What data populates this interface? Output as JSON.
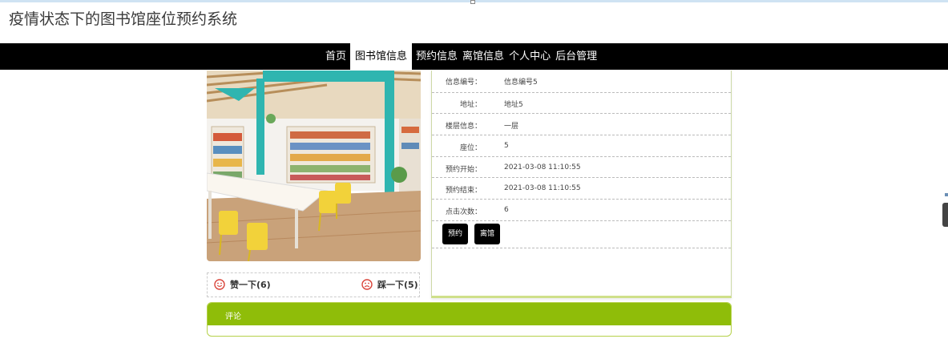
{
  "site": {
    "title": "疫情状态下的图书馆座位预约系统"
  },
  "nav": {
    "items": [
      {
        "label": "首页",
        "active": false
      },
      {
        "label": "图书馆信息",
        "active": true
      },
      {
        "label": "预约信息",
        "active": false
      },
      {
        "label": "离馆信息",
        "active": false
      },
      {
        "label": "个人中心",
        "active": false
      },
      {
        "label": "后台管理",
        "active": false
      }
    ]
  },
  "details": {
    "rows": [
      {
        "label": "信息编号：",
        "value": "信息编号5"
      },
      {
        "label": "地址：",
        "value": "地址5"
      },
      {
        "label": "楼层信息：",
        "value": "一层"
      },
      {
        "label": "座位：",
        "value": "5"
      },
      {
        "label": "预约开始：",
        "value": "2021-03-08 11:10:55"
      },
      {
        "label": "预约结束：",
        "value": "2021-03-08 11:10:55"
      },
      {
        "label": "点击次数：",
        "value": "6"
      }
    ],
    "buttons": {
      "reserve": "预约",
      "leave": "离馆"
    }
  },
  "votes": {
    "like_label": "赞一下(6)",
    "dislike_label": "踩一下(5)"
  },
  "comments": {
    "title": "评论"
  },
  "colors": {
    "accent": "#8fbd09",
    "nav_bg": "#000000",
    "teal": "#2fb5b0",
    "chair": "#f2d23a"
  },
  "icons": {
    "like": "smile-icon",
    "dislike": "frown-icon"
  }
}
